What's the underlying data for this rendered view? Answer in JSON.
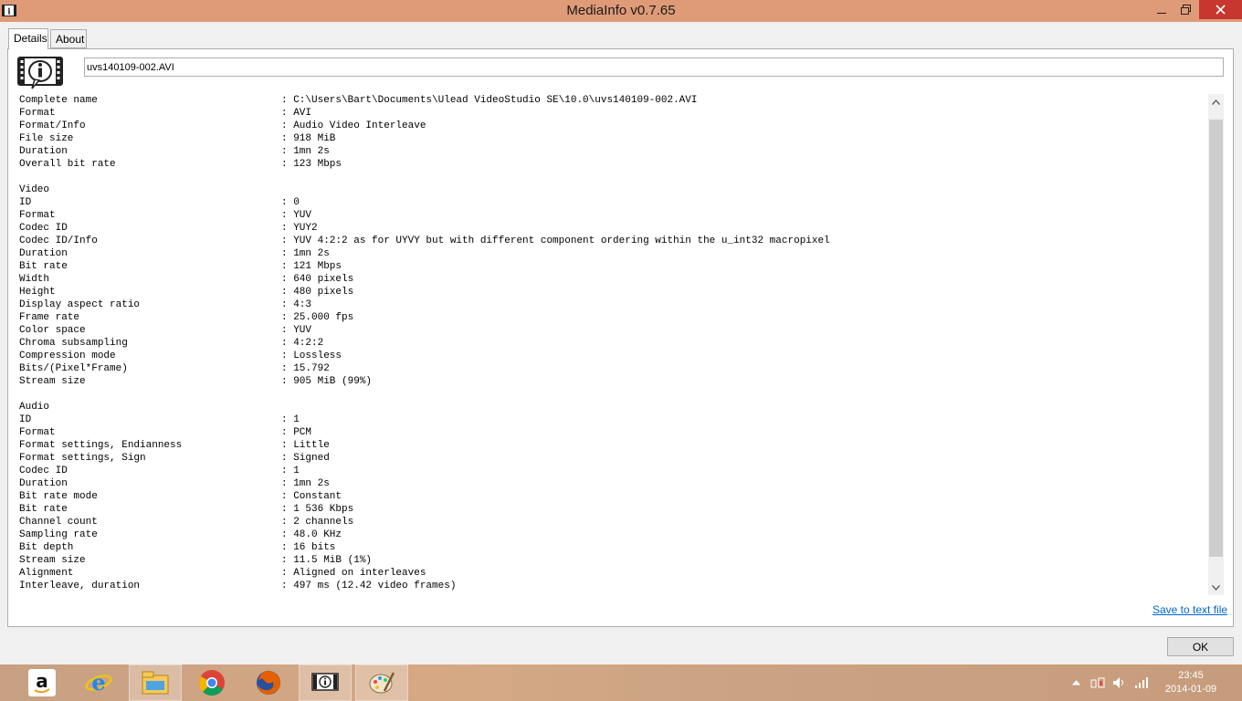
{
  "window": {
    "title": "MediaInfo v0.7.65"
  },
  "tabs": [
    {
      "label": "Details"
    },
    {
      "label": "About"
    }
  ],
  "file": {
    "name": "uvs140109-002.AVI"
  },
  "rows": [
    {
      "k": "Complete name",
      "v": ": C:\\Users\\Bart\\Documents\\Ulead VideoStudio SE\\10.0\\uvs140109-002.AVI"
    },
    {
      "k": "Format",
      "v": ": AVI"
    },
    {
      "k": "Format/Info",
      "v": ": Audio Video Interleave"
    },
    {
      "k": "File size",
      "v": ": 918 MiB"
    },
    {
      "k": "Duration",
      "v": ": 1mn 2s"
    },
    {
      "k": "Overall bit rate",
      "v": ": 123 Mbps"
    },
    {
      "k": "",
      "v": ""
    },
    {
      "k": "Video",
      "v": ""
    },
    {
      "k": "ID",
      "v": ": 0"
    },
    {
      "k": "Format",
      "v": ": YUV"
    },
    {
      "k": "Codec ID",
      "v": ": YUY2"
    },
    {
      "k": "Codec ID/Info",
      "v": ": YUV 4:2:2 as for UYVY but with different component ordering within the u_int32 macropixel"
    },
    {
      "k": "Duration",
      "v": ": 1mn 2s"
    },
    {
      "k": "Bit rate",
      "v": ": 121 Mbps"
    },
    {
      "k": "Width",
      "v": ": 640 pixels"
    },
    {
      "k": "Height",
      "v": ": 480 pixels"
    },
    {
      "k": "Display aspect ratio",
      "v": ": 4:3"
    },
    {
      "k": "Frame rate",
      "v": ": 25.000 fps"
    },
    {
      "k": "Color space",
      "v": ": YUV"
    },
    {
      "k": "Chroma subsampling",
      "v": ": 4:2:2"
    },
    {
      "k": "Compression mode",
      "v": ": Lossless"
    },
    {
      "k": "Bits/(Pixel*Frame)",
      "v": ": 15.792"
    },
    {
      "k": "Stream size",
      "v": ": 905 MiB (99%)"
    },
    {
      "k": "",
      "v": ""
    },
    {
      "k": "Audio",
      "v": ""
    },
    {
      "k": "ID",
      "v": ": 1"
    },
    {
      "k": "Format",
      "v": ": PCM"
    },
    {
      "k": "Format settings, Endianness",
      "v": ": Little"
    },
    {
      "k": "Format settings, Sign",
      "v": ": Signed"
    },
    {
      "k": "Codec ID",
      "v": ": 1"
    },
    {
      "k": "Duration",
      "v": ": 1mn 2s"
    },
    {
      "k": "Bit rate mode",
      "v": ": Constant"
    },
    {
      "k": "Bit rate",
      "v": ": 1 536 Kbps"
    },
    {
      "k": "Channel count",
      "v": ": 2 channels"
    },
    {
      "k": "Sampling rate",
      "v": ": 48.0 KHz"
    },
    {
      "k": "Bit depth",
      "v": ": 16 bits"
    },
    {
      "k": "Stream size",
      "v": ": 11.5 MiB (1%)"
    },
    {
      "k": "Alignment",
      "v": ": Aligned on interleaves"
    },
    {
      "k": "Interleave, duration",
      "v": ": 497 ms (12.42 video frames)"
    }
  ],
  "footer": {
    "save_link": "Save to text file",
    "ok": "OK"
  },
  "taskbar": {
    "apps": [
      "amazon-icon",
      "internet-explorer-icon",
      "file-explorer-icon",
      "chrome-icon",
      "firefox-icon",
      "mediainfo-icon",
      "paint-icon"
    ],
    "clock_time": "23:45",
    "clock_date": "2014-01-09"
  },
  "colors": {
    "titlebar": "#df9a78",
    "close": "#c7372f",
    "link": "#0066cc"
  }
}
